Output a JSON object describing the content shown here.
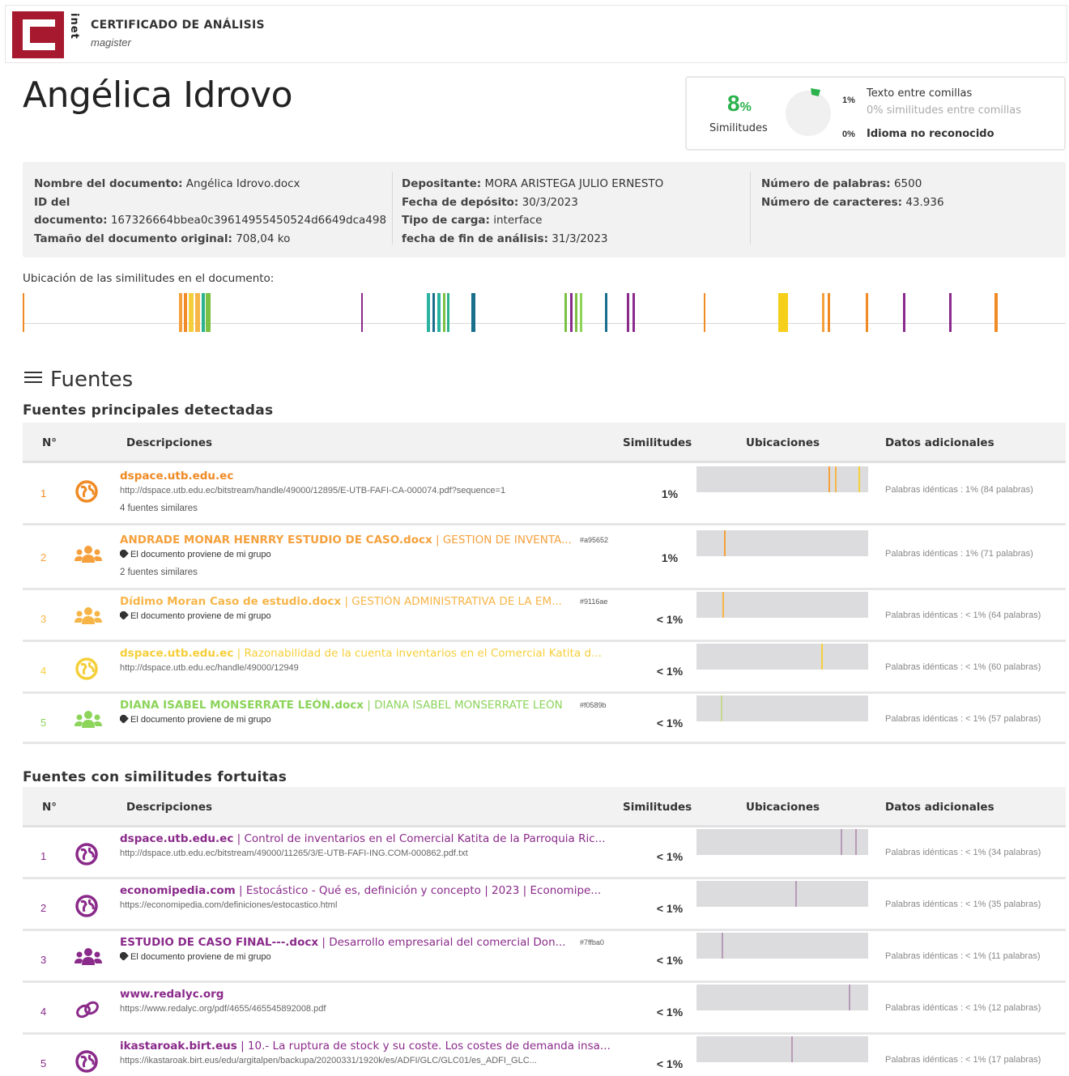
{
  "header": {
    "logo_text": "inet",
    "title": "CERTIFICADO DE ANÁLISIS",
    "subtitle": "magister"
  },
  "document": {
    "author": "Angélica Idrovo"
  },
  "similarity": {
    "percent": "8",
    "percent_sign": "%",
    "label": "Similitudes",
    "quoted_pct": "1%",
    "quoted_label": "Texto entre comillas",
    "quoted_sub": "0% similitudes entre comillas",
    "lang_pct": "0%",
    "lang_label": "Idioma no reconocido"
  },
  "info": {
    "col1": [
      {
        "k": "Nombre del documento:",
        "v": "Angélica Idrovo.docx"
      },
      {
        "k": "ID del",
        "v": ""
      },
      {
        "k": "documento:",
        "v": "167326664bbea0c39614955450524d6649dca498"
      },
      {
        "k": "Tamaño del documento original:",
        "v": "708,04 ko"
      }
    ],
    "col2": [
      {
        "k": "Depositante:",
        "v": "MORA ARISTEGA JULIO ERNESTO"
      },
      {
        "k": "Fecha de depósito:",
        "v": "30/3/2023"
      },
      {
        "k": "Tipo de carga:",
        "v": "interface"
      },
      {
        "k": "fecha de fin de análisis:",
        "v": "31/3/2023"
      }
    ],
    "col3": [
      {
        "k": "Número de palabras:",
        "v": "6500"
      },
      {
        "k": "Número de caracteres:",
        "v": "43.936"
      }
    ]
  },
  "location_label": "Ubicación de las similitudes en el documento:",
  "fuentes_title": "Fuentes",
  "principal_title": "Fuentes principales detectadas",
  "fortuitas_title": "Fuentes con similitudes fortuitas",
  "table_headers": {
    "num": "N°",
    "desc": "Descripciones",
    "sim": "Similitudes",
    "loc": "Ubicaciones",
    "extra": "Datos adicionales"
  },
  "principal": [
    {
      "n": "1",
      "name": "dspace.utb.edu.ec",
      "rest": "",
      "hash": "",
      "sub": "http://dspace.utb.edu.ec/bitstream/handle/49000/12895/E-UTB-FAFI-CA-000074.pdf?sequence=1",
      "sub2": "4 fuentes similares",
      "sim": "1%",
      "extra": "Palabras idénticas : 1% (84 palabras)",
      "color": "#f08a24",
      "icon": "globe"
    },
    {
      "n": "2",
      "name": "ANDRADE MONAR HENRRY ESTUDIO DE CASO.docx",
      "rest": " | GESTION DE INVENTA...",
      "hash": "#a95652",
      "sub": "El documento proviene de mi grupo",
      "sub2": "2 fuentes similares",
      "sim": "1%",
      "extra": "Palabras idénticas : 1% (71 palabras)",
      "color": "#f5a03c",
      "icon": "group"
    },
    {
      "n": "3",
      "name": "Dídimo Moran Caso de estudio.docx",
      "rest": " | GESTIÓN ADMINISTRATIVA DE LA EM...",
      "hash": "#9116ae",
      "sub": "El documento proviene de mi grupo",
      "sub2": "",
      "sim": "< 1%",
      "extra": "Palabras idénticas : < 1% (64 palabras)",
      "color": "#f7b548",
      "icon": "group"
    },
    {
      "n": "4",
      "name": "dspace.utb.edu.ec",
      "rest": " | Razonabilidad de la cuenta inventarios en el Comercial Katita d...",
      "hash": "",
      "sub": "http://dspace.utb.edu.ec/handle/49000/12949",
      "sub2": "",
      "sim": "< 1%",
      "extra": "Palabras idénticas : < 1% (60 palabras)",
      "color": "#f5cf3a",
      "icon": "globe"
    },
    {
      "n": "5",
      "name": "DIANA ISABEL MONSERRATE LEÓN.docx",
      "rest": " | DIANA ISABEL MONSERRATE LEÓN",
      "hash": "#f0589b",
      "sub": "El documento proviene de mi grupo",
      "sub2": "",
      "sim": "< 1%",
      "extra": "Palabras idénticas : < 1% (57 palabras)",
      "color": "#8cd45a",
      "icon": "group"
    }
  ],
  "fortuitas": [
    {
      "n": "1",
      "name": "dspace.utb.edu.ec",
      "rest": " | Control de inventarios en el Comercial Katita de la Parroquia Ric...",
      "hash": "",
      "sub": "http://dspace.utb.edu.ec/bitstream/49000/11265/3/E-UTB-FAFI-ING.COM-000862.pdf.txt",
      "sim": "< 1%",
      "extra": "Palabras idénticas : < 1% (34 palabras)",
      "color": "#8a2a8a",
      "icon": "globe"
    },
    {
      "n": "2",
      "name": "economipedia.com",
      "rest": " | Estocástico - Qué es, definición y concepto | 2023 | Economipe...",
      "hash": "",
      "sub": "https://economipedia.com/definiciones/estocastico.html",
      "sim": "< 1%",
      "extra": "Palabras idénticas : < 1% (35 palabras)",
      "color": "#8a2a8a",
      "icon": "globe"
    },
    {
      "n": "3",
      "name": "ESTUDIO DE CASO FINAL---.docx",
      "rest": " | Desarrollo empresarial del comercial Don...",
      "hash": "#7ffba0",
      "sub": "El documento proviene de mi grupo",
      "sim": "< 1%",
      "extra": "Palabras idénticas : < 1% (11 palabras)",
      "color": "#8a2a8a",
      "icon": "group"
    },
    {
      "n": "4",
      "name": "www.redalyc.org",
      "rest": "",
      "hash": "",
      "sub": "https://www.redalyc.org/pdf/4655/465545892008.pdf",
      "sim": "< 1%",
      "extra": "Palabras idénticas : < 1% (12 palabras)",
      "color": "#8a2a8a",
      "icon": "link"
    },
    {
      "n": "5",
      "name": "ikastaroak.birt.eus",
      "rest": " | 10.- La ruptura de stock y su coste. Los costes de demanda insa...",
      "hash": "",
      "sub": "https://ikastaroak.birt.eus/edu/argitalpen/backupa/20200331/1920k/es/ADFI/GLC/GLC01/es_ADFI_GLC...",
      "sim": "< 1%",
      "extra": "Palabras idénticas : < 1% (17 palabras)",
      "color": "#8a2a8a",
      "icon": "globe"
    }
  ]
}
